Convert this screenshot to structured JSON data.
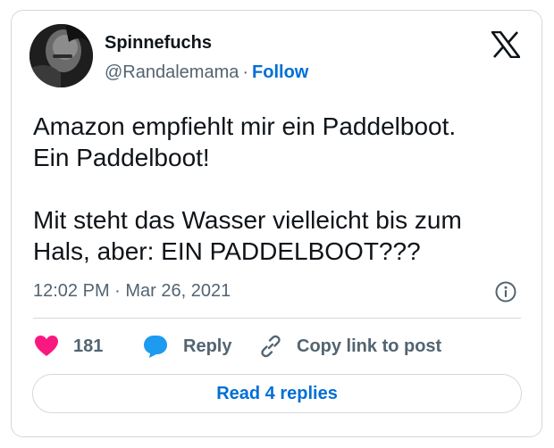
{
  "author": {
    "display_name": "Spinnefuchs",
    "handle": "@Randalemama",
    "separator": "·",
    "follow_label": "Follow"
  },
  "tweet": {
    "lines": [
      "Amazon empfiehlt mir ein Paddelboot.",
      "Ein Paddelboot!",
      "",
      "Mit steht das Wasser vielleicht bis zum",
      "Hals, aber: EIN PADDELBOOT???"
    ],
    "timestamp": "12:02 PM · Mar 26, 2021"
  },
  "actions": {
    "like_count": "181",
    "reply_label": "Reply",
    "copy_label": "Copy link to post"
  },
  "footer": {
    "read_replies_label": "Read 4 replies"
  },
  "icons": {
    "brand": "x-logo-icon",
    "info": "info-icon",
    "like": "heart-icon",
    "reply": "reply-bubble-icon",
    "copy": "link-icon"
  },
  "colors": {
    "heart": "#f91880",
    "reply_bubble": "#1d9bf0",
    "link_blue": "#006fd6",
    "secondary_text": "#536471",
    "primary_text": "#0f1419",
    "border": "#cfd9de"
  }
}
